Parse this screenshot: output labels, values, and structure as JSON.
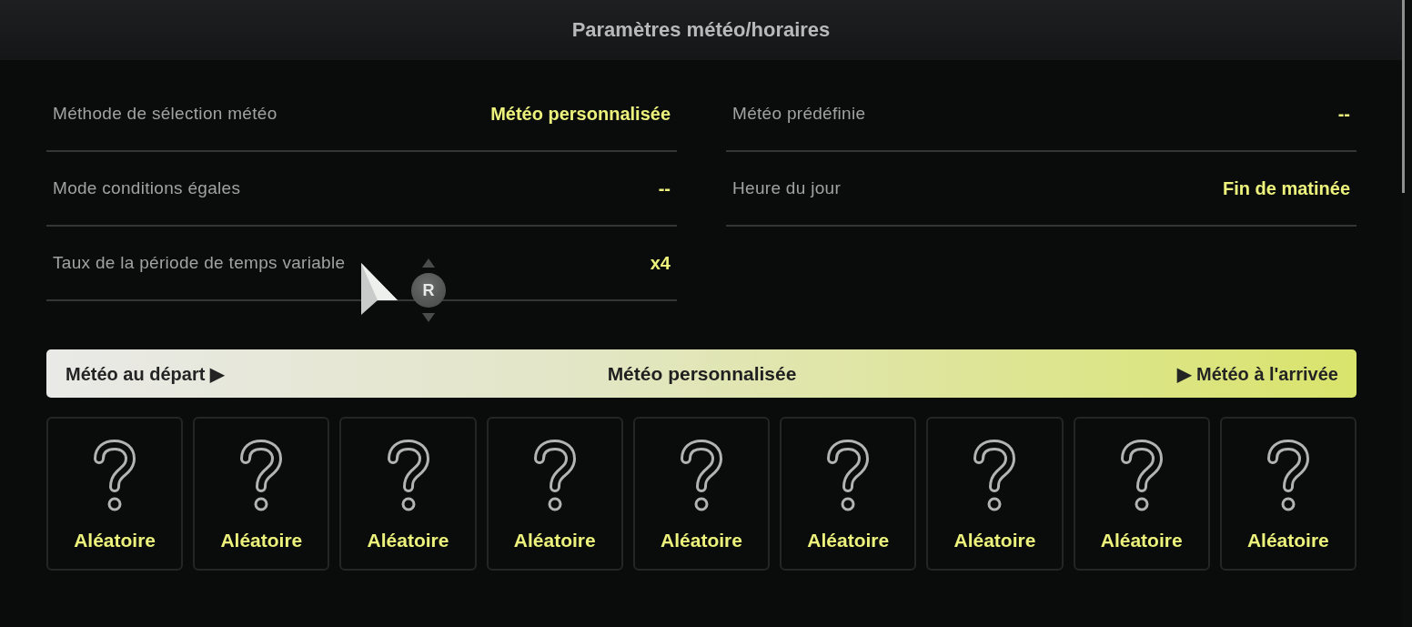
{
  "window": {
    "title": "Paramètres météo/horaires"
  },
  "settings_columns": [
    {
      "rows": [
        {
          "label": "Méthode de sélection météo",
          "value": "Météo personnalisée"
        },
        {
          "label": "Mode conditions égales",
          "value": "--"
        },
        {
          "label": "Taux de la période de temps variable",
          "value": "x4"
        }
      ]
    },
    {
      "rows": [
        {
          "label": "Météo prédéfinie",
          "value": "--"
        },
        {
          "label": "Heure du jour",
          "value": "Fin de matinée"
        }
      ]
    }
  ],
  "cursor": {
    "button_label": "R"
  },
  "weather_banner": {
    "previous": "Météo au départ ▶",
    "title": "Météo personnalisée",
    "next": "▶ Météo à l'arrivée"
  },
  "weather_slots": [
    {
      "label": "Aléatoire"
    },
    {
      "label": "Aléatoire"
    },
    {
      "label": "Aléatoire"
    },
    {
      "label": "Aléatoire"
    },
    {
      "label": "Aléatoire"
    },
    {
      "label": "Aléatoire"
    },
    {
      "label": "Aléatoire"
    },
    {
      "label": "Aléatoire"
    },
    {
      "label": "Aléatoire"
    }
  ]
}
